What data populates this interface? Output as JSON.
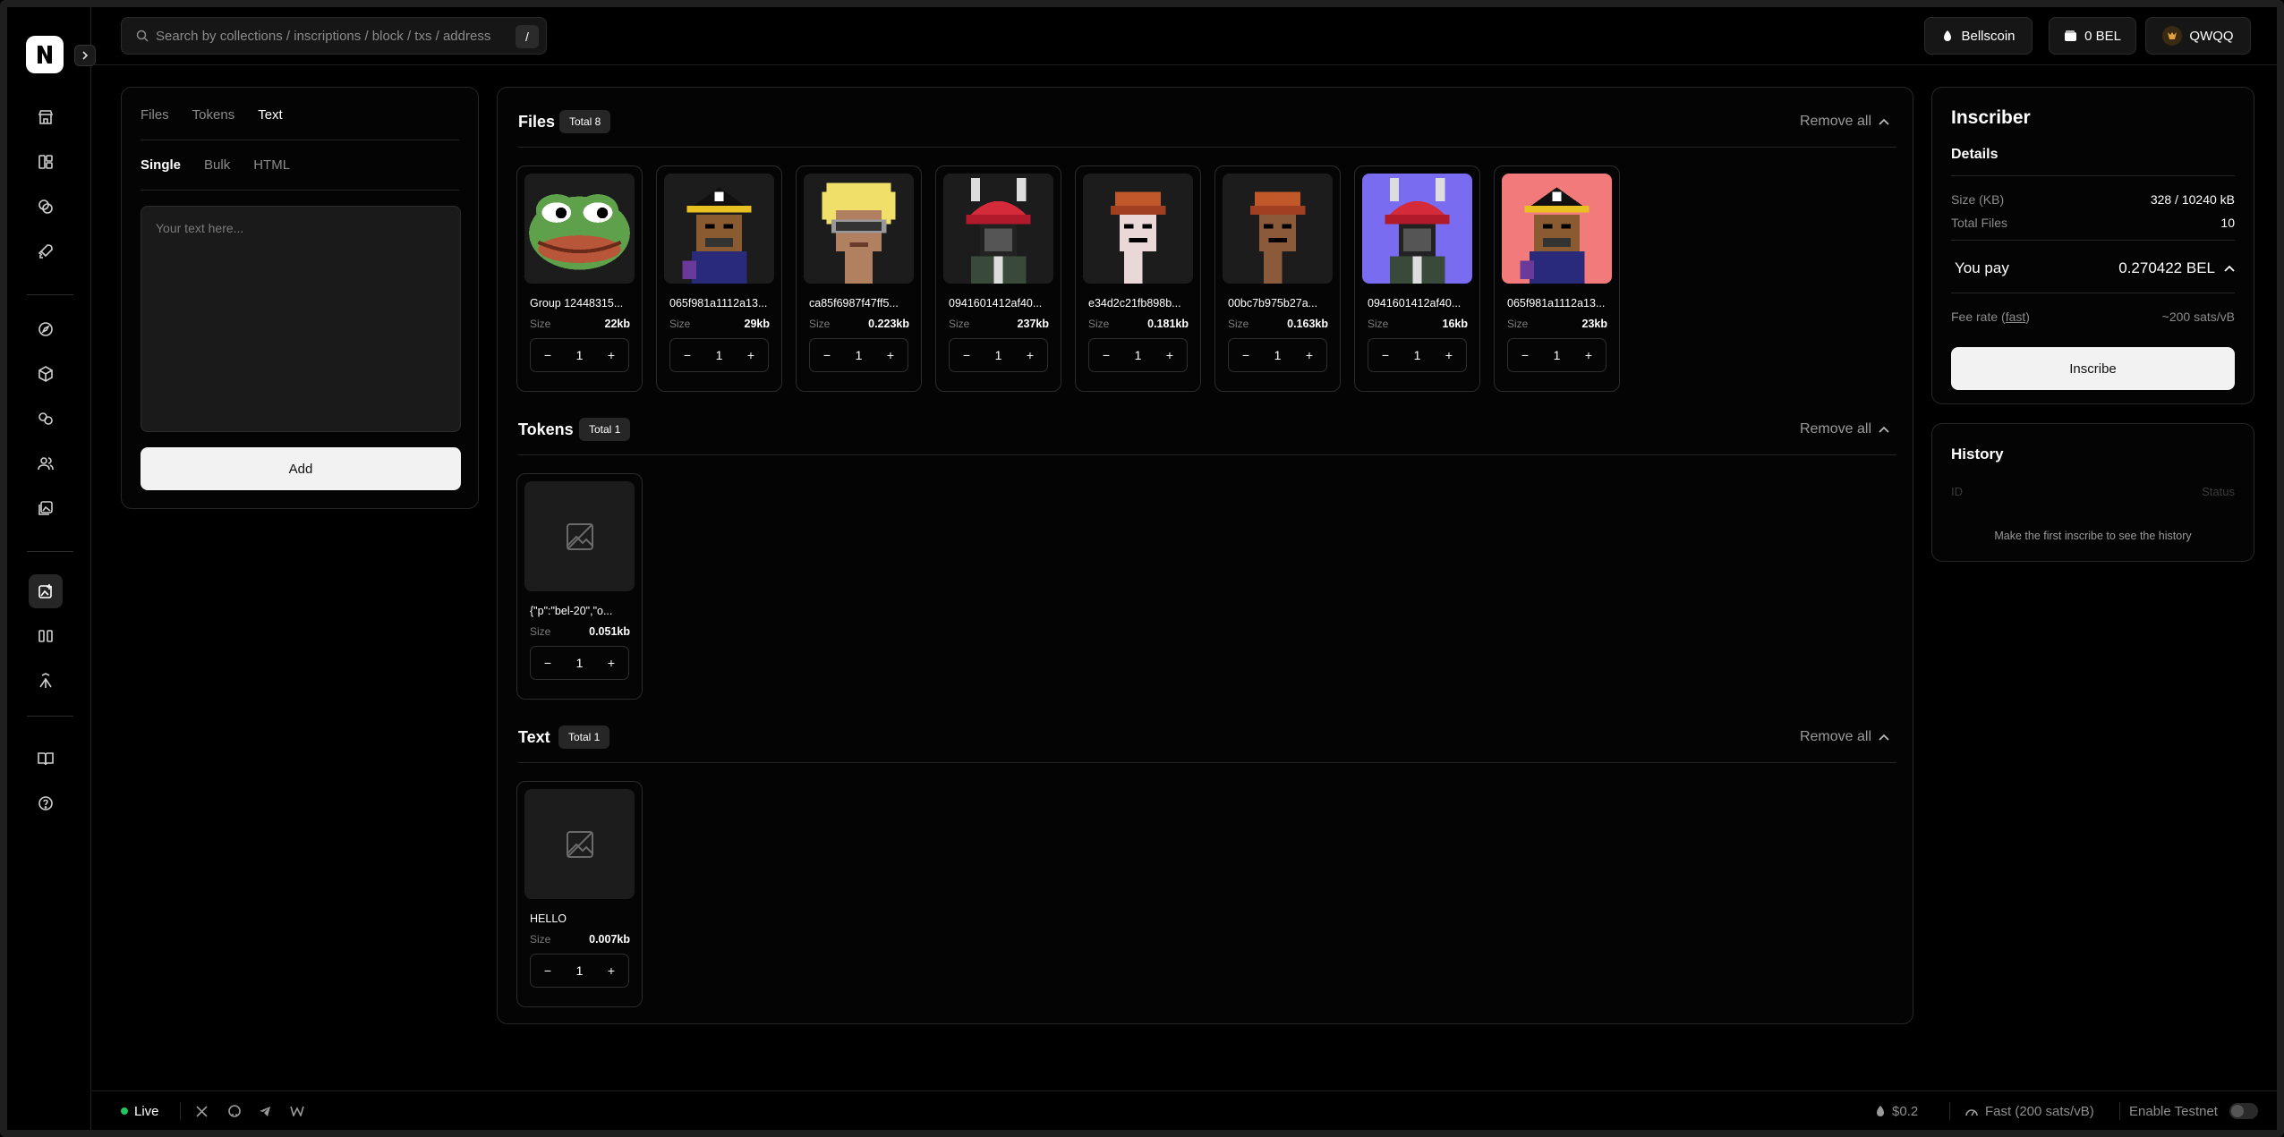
{
  "header": {
    "search_placeholder": "Search by collections / inscriptions / block / txs / address",
    "search_shortcut": "/",
    "network_label": "Bellscoin",
    "balance_label": "0 BEL",
    "user_label": "QWQQ"
  },
  "left_panel": {
    "tabs": [
      "Files",
      "Tokens",
      "Text"
    ],
    "active_tab": "Text",
    "subtabs": [
      "Single",
      "Bulk",
      "HTML"
    ],
    "active_subtab": "Single",
    "text_placeholder": "Your text here...",
    "add_label": "Add"
  },
  "files": {
    "title": "Files",
    "total": "Total 8",
    "remove_all": "Remove all",
    "size_label": "Size",
    "items": [
      {
        "name": "Group 12448315...",
        "size": "22kb",
        "qty": "1"
      },
      {
        "name": "065f981a1112a13...",
        "size": "29kb",
        "qty": "1"
      },
      {
        "name": "ca85f6987f47ff5...",
        "size": "0.223kb",
        "qty": "1"
      },
      {
        "name": "0941601412af40...",
        "size": "237kb",
        "qty": "1"
      },
      {
        "name": "e34d2c21fb898b...",
        "size": "0.181kb",
        "qty": "1"
      },
      {
        "name": "00bc7b975b27a...",
        "size": "0.163kb",
        "qty": "1"
      },
      {
        "name": "0941601412af40...",
        "size": "16kb",
        "qty": "1"
      },
      {
        "name": "065f981a1112a13...",
        "size": "23kb",
        "qty": "1"
      }
    ]
  },
  "tokens": {
    "title": "Tokens",
    "total": "Total 1",
    "remove_all": "Remove all",
    "items": [
      {
        "name": "{\"p\":\"bel-20\",\"o...",
        "size": "0.051kb",
        "qty": "1"
      }
    ]
  },
  "texts": {
    "title": "Text",
    "total": "Total 1",
    "remove_all": "Remove all",
    "items": [
      {
        "name": "HELLO",
        "size": "0.007kb",
        "qty": "1"
      }
    ]
  },
  "inscriber": {
    "title": "Inscriber",
    "details": "Details",
    "size_label": "Size (KB)",
    "size_value": "328 / 10240 kB",
    "total_files_label": "Total Files",
    "total_files_value": "10",
    "you_pay_label": "You pay",
    "you_pay_value": "0.270422 BEL",
    "fee_label": "Fee rate (",
    "fee_link": "fast",
    "fee_label_end": ")",
    "fee_value": "~200 sats/vB",
    "inscribe_label": "Inscribe"
  },
  "history": {
    "title": "History",
    "col_id": "ID",
    "col_status": "Status",
    "empty": "Make the first inscribe to see the history"
  },
  "footer": {
    "live": "Live",
    "price": "$0.2",
    "fee": "Fast (200 sats/vB)",
    "testnet": "Enable Testnet"
  },
  "colors": {
    "background": "#000000",
    "panel_border": "#262626",
    "accent_live": "#22c55e",
    "button_light": "#f2f2f2"
  }
}
